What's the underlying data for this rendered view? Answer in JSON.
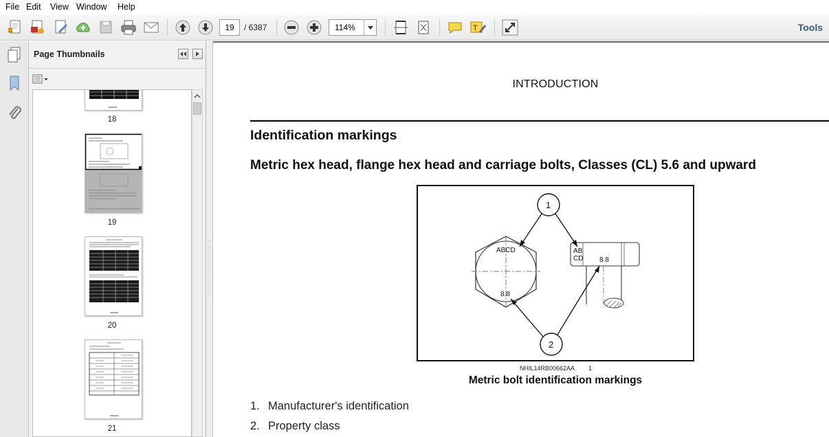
{
  "menu": [
    "File",
    "Edit",
    "View",
    "Window",
    "Help"
  ],
  "toolbar": {
    "current_page": "19",
    "total_pages": "/ 6387",
    "zoom": "114%",
    "tools_label": "Tools"
  },
  "panel": {
    "title": "Page Thumbnails",
    "thumbnails": [
      {
        "page": "18"
      },
      {
        "page": "19"
      },
      {
        "page": "20"
      },
      {
        "page": "21"
      }
    ]
  },
  "document": {
    "header": "INTRODUCTION",
    "heading": "Identification markings",
    "subheading": "Metric hex head, flange hex head and carriage bolts, Classes (CL) 5.6 and upward",
    "figure": {
      "callout_1": "1",
      "callout_2": "2",
      "marking_left": "ABCD",
      "class_left": "8.8",
      "marking_right_top": "AB",
      "marking_right_bottom": "CD",
      "class_right": "8.8",
      "code": "NHIL14RB00662AA",
      "code_index": "1"
    },
    "caption": "Metric bolt identification markings",
    "list": [
      {
        "num": "1.",
        "text": "Manufacturer's identification"
      },
      {
        "num": "2.",
        "text": "Property class"
      }
    ]
  }
}
